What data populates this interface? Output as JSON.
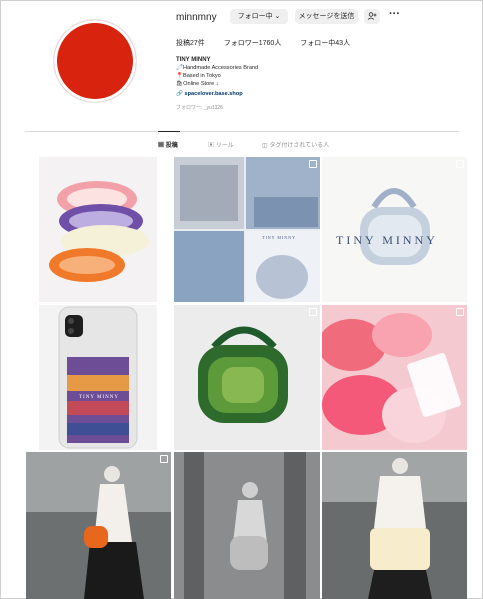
{
  "profile": {
    "username": "minnmny",
    "follow_button": "フォロー中 ⌄",
    "message_button": "メッセージを送信",
    "more_icon": "more-horizontal-icon",
    "stats": {
      "posts": "投稿27件",
      "followers": "フォロワー1760人",
      "following": "フォロー中43人"
    },
    "bio": {
      "name": "TINY MINNY",
      "lines": [
        "🧷Handmade Accessories Brand",
        "📍Based in Tokyo",
        "🛍Online Store ↓"
      ],
      "link": "spacelover.base.shop"
    },
    "followed_by": "フォロワー: _yu1326",
    "avatar_color": "#d8230f"
  },
  "tabs": [
    {
      "label": "投稿",
      "icon": "grid-icon"
    },
    {
      "label": "リール",
      "icon": "reels-icon"
    },
    {
      "label": "タグ付けされている人",
      "icon": "tag-icon"
    }
  ],
  "posts": [
    {
      "overlay_text": ""
    },
    {
      "overlay_text": "TINY MINNY"
    },
    {
      "overlay_text": "TINY MINNY"
    },
    {
      "overlay_text": "TINY MINNY"
    },
    {
      "overlay_text": ""
    },
    {
      "overlay_text": ""
    },
    {
      "overlay_text": ""
    },
    {
      "overlay_text": ""
    },
    {
      "overlay_text": ""
    }
  ],
  "colors": {
    "accent_link": "#00376b",
    "muted": "#8e8e8e",
    "button_bg": "#efefef"
  }
}
